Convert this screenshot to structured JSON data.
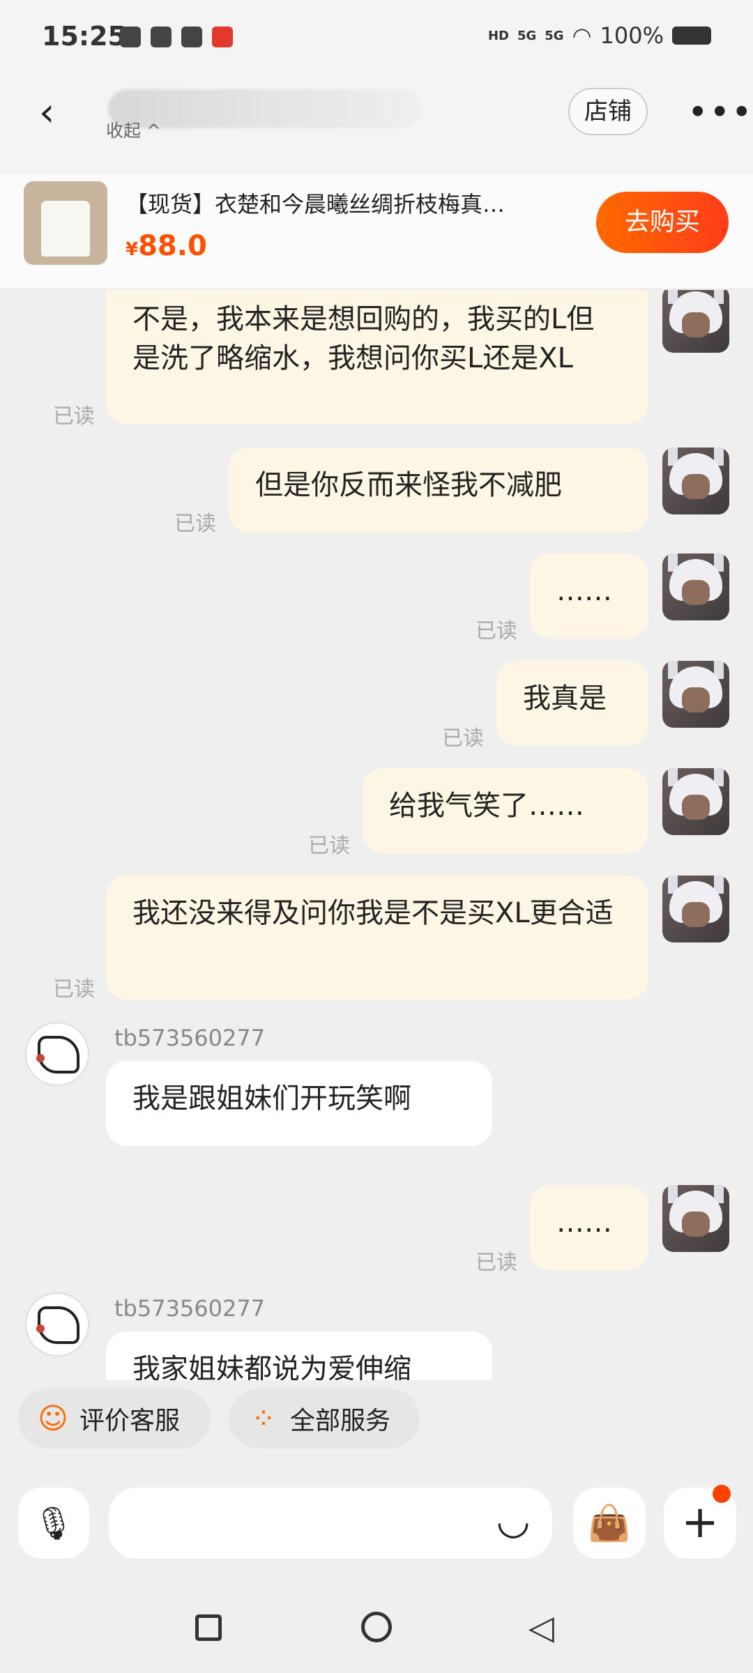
{
  "status_bar": {
    "time": "15:25",
    "battery": "100%",
    "network": [
      "HD",
      "5G",
      "5G"
    ]
  },
  "header": {
    "back_icon": "chevron-left-icon",
    "collapse_label": "收起 ^",
    "store_label": "店铺",
    "more_label": "•••"
  },
  "product": {
    "title": "【现货】衣楚和今晨曦丝绸折枝梅真…",
    "currency": "¥",
    "price": "88.0",
    "buy_label": "去购买"
  },
  "chat": {
    "read_label": "已读",
    "messages": [
      {
        "from": "me",
        "text": "不是，我本来是想回购的，我买的L但是洗了略缩水，我想问你买L还是XL",
        "read": "已读"
      },
      {
        "from": "me",
        "text": "但是你反而来怪我不减肥",
        "read": "已读"
      },
      {
        "from": "me",
        "text": "……",
        "read": "已读"
      },
      {
        "from": "me",
        "text": "我真是",
        "read": "已读"
      },
      {
        "from": "me",
        "text": "给我气笑了……",
        "read": "已读"
      },
      {
        "from": "me",
        "text": "我还没来得及问你我是不是买XL更合适",
        "read": "已读"
      },
      {
        "from": "shop",
        "user": "tb573560277",
        "text": "我是跟姐妹们开玩笑啊"
      },
      {
        "from": "me",
        "text": "……",
        "read": "已读"
      },
      {
        "from": "shop",
        "user": "tb573560277",
        "text": "我家姐妹都说为爱伸缩"
      }
    ]
  },
  "quick_actions": {
    "rate_label": "评价客服",
    "all_services_label": "全部服务"
  },
  "input": {
    "placeholder": ""
  },
  "colors": {
    "accent": "#ff5000",
    "my_bubble": "#fdf6e4",
    "their_bubble": "#ffffff",
    "background": "#efefef"
  }
}
